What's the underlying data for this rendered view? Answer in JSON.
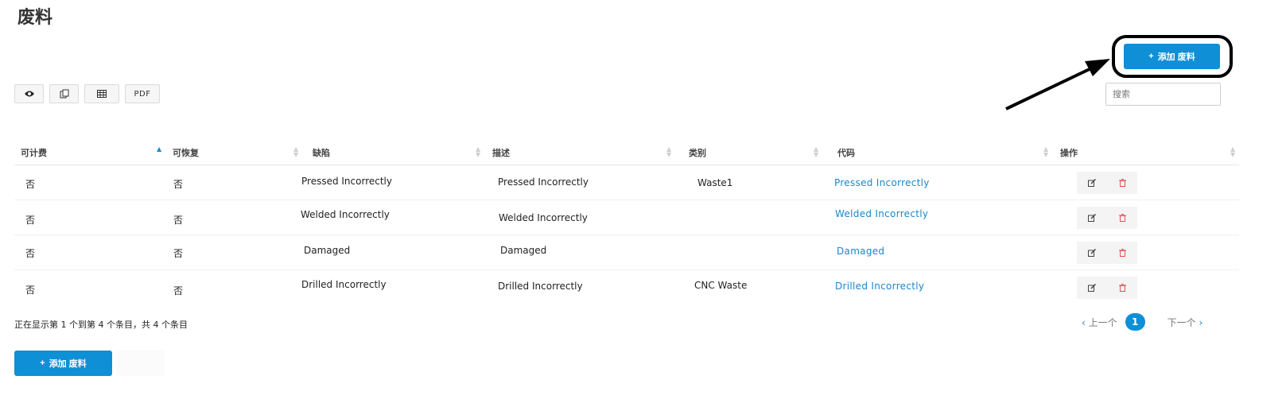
{
  "page": {
    "title": "废料"
  },
  "toolbar": {
    "buttons": [
      {
        "icon": "eye-icon"
      },
      {
        "icon": "copy-icon"
      },
      {
        "icon": "table-icon"
      },
      {
        "label": "PDF"
      }
    ]
  },
  "add_button": {
    "plus": "+",
    "label": "添加 废料"
  },
  "search": {
    "placeholder": "搜索"
  },
  "table": {
    "columns": [
      "可计费",
      "可恢复",
      "缺陷",
      "描述",
      "类别",
      "代码",
      "操作"
    ],
    "rows": [
      {
        "billable": "否",
        "recoverable": "否",
        "defect": "Pressed Incorrectly",
        "description": "Pressed Incorrectly",
        "category": "Waste1",
        "code": "Pressed Incorrectly"
      },
      {
        "billable": "否",
        "recoverable": "否",
        "defect": "Welded Incorrectly",
        "description": "Welded Incorrectly",
        "category": "",
        "code": "Welded Incorrectly"
      },
      {
        "billable": "否",
        "recoverable": "否",
        "defect": "Damaged",
        "description": "Damaged",
        "category": "",
        "code": "Damaged"
      },
      {
        "billable": "否",
        "recoverable": "否",
        "defect": "Drilled Incorrectly",
        "description": "Drilled Incorrectly",
        "category": "CNC Waste",
        "code": "Drilled Incorrectly"
      }
    ]
  },
  "footer": {
    "info": "正在显示第 1 个到第 4  个条目，共 4  个条目",
    "pager": {
      "prev": "上一个",
      "current": "1",
      "next": "下一个",
      "chevron_left": "‹",
      "chevron_right": "›"
    }
  },
  "colors": {
    "accent": "#0e8fd6",
    "link": "#1a86cc",
    "delete": "#e05050"
  }
}
